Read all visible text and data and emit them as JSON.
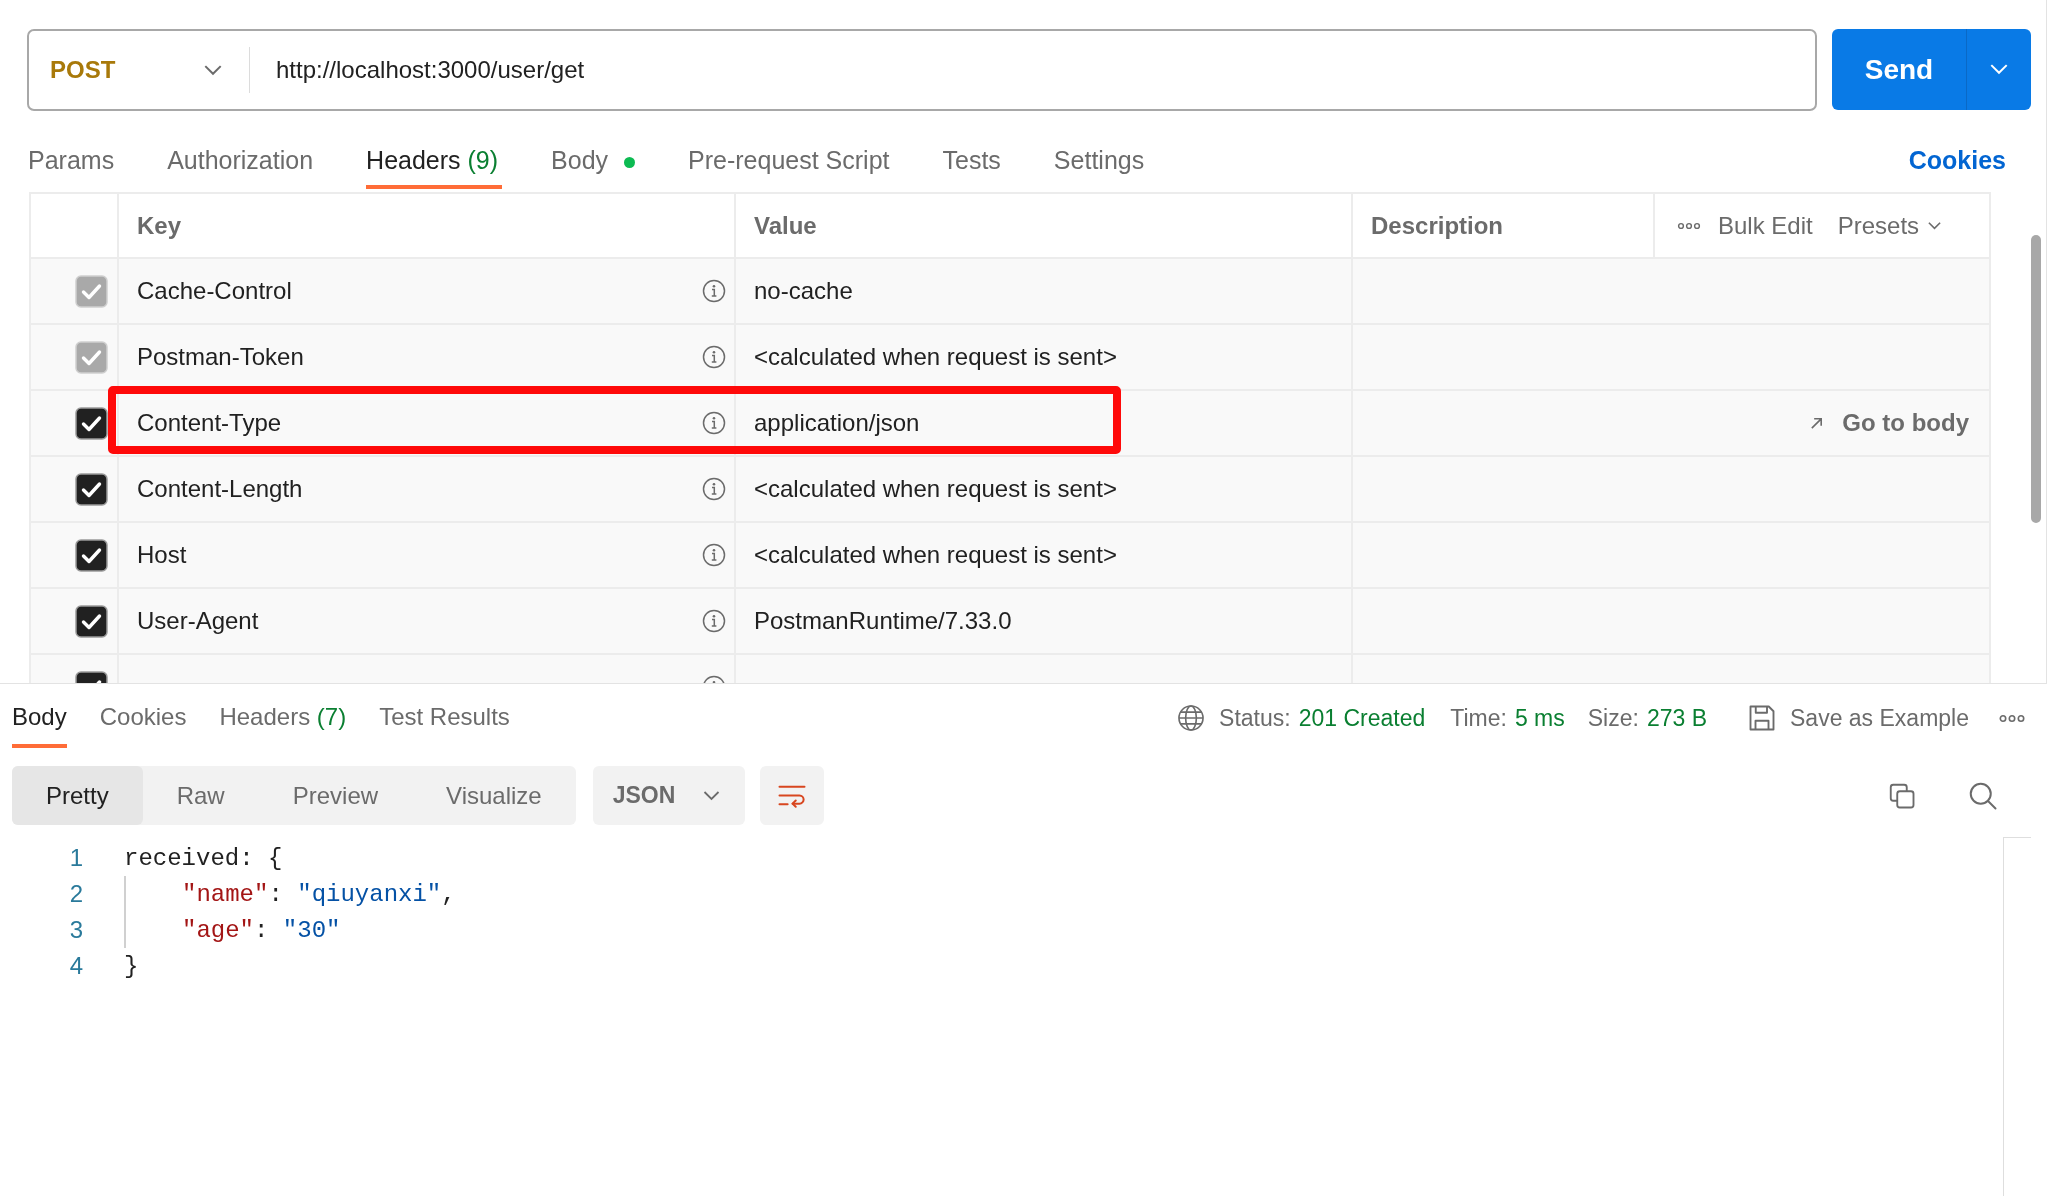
{
  "request": {
    "method": "POST",
    "url": "http://localhost:3000/user/get",
    "send": "Send"
  },
  "request_tabs": [
    {
      "label": "Params",
      "selected": false
    },
    {
      "label": "Authorization",
      "selected": false
    },
    {
      "label": "Headers",
      "count": "(9)",
      "selected": true
    },
    {
      "label": "Body",
      "dot": true,
      "selected": false
    },
    {
      "label": "Pre-request Script",
      "selected": false
    },
    {
      "label": "Tests",
      "selected": false
    },
    {
      "label": "Settings",
      "selected": false
    }
  ],
  "cookies_link": "Cookies",
  "headers_table": {
    "columns": [
      "Key",
      "Value",
      "Description"
    ],
    "actions": [
      "Bulk Edit",
      "Presets"
    ],
    "rows": [
      {
        "checked": true,
        "disabled": true,
        "highlighted": false,
        "key": "Cache-Control",
        "value": "no-cache"
      },
      {
        "checked": true,
        "disabled": true,
        "highlighted": false,
        "key": "Postman-Token",
        "value": "<calculated when request is sent>"
      },
      {
        "checked": true,
        "disabled": false,
        "highlighted": true,
        "key": "Content-Type",
        "value": "application/json",
        "link": "Go to body"
      },
      {
        "checked": true,
        "disabled": false,
        "highlighted": false,
        "key": "Content-Length",
        "value": "<calculated when request is sent>"
      },
      {
        "checked": true,
        "disabled": false,
        "highlighted": false,
        "key": "Host",
        "value": "<calculated when request is sent>"
      },
      {
        "checked": true,
        "disabled": false,
        "highlighted": false,
        "key": "User-Agent",
        "value": "PostmanRuntime/7.33.0"
      },
      {
        "checked": true,
        "disabled": false,
        "highlighted": false
      }
    ]
  },
  "response": {
    "tabs": [
      {
        "label": "Body",
        "selected": true
      },
      {
        "label": "Cookies",
        "selected": false
      },
      {
        "label": "Headers",
        "count": "(7)",
        "selected": false
      },
      {
        "label": "Test Results",
        "selected": false
      }
    ],
    "status_label": "Status:",
    "status": "201 Created",
    "time_label": "Time:",
    "time": "5 ms",
    "size_label": "Size:",
    "size": "273 B",
    "save": "Save as Example",
    "view_modes": [
      {
        "label": "Pretty",
        "selected": true
      },
      {
        "label": "Raw",
        "selected": false
      },
      {
        "label": "Preview",
        "selected": false
      },
      {
        "label": "Visualize",
        "selected": false
      }
    ],
    "format": "JSON",
    "code_lines": [
      {
        "number": "1",
        "tokens": [
          {
            "kind": "plain",
            "text": "received: {"
          }
        ],
        "children": [
          {
            "number": "2",
            "tokens": [
              {
                "kind": "key",
                "text": "\"name\""
              },
              {
                "kind": "plain",
                "text": ": "
              },
              {
                "kind": "string",
                "text": "\"qiuyanxi\""
              },
              {
                "kind": "plain",
                "text": ","
              }
            ]
          },
          {
            "number": "3",
            "tokens": [
              {
                "kind": "key",
                "text": "\"age\""
              },
              {
                "kind": "plain",
                "text": ": "
              },
              {
                "kind": "string",
                "text": "\"30\""
              }
            ]
          }
        ]
      },
      {
        "number": "4",
        "tokens": [
          {
            "kind": "plain",
            "text": "}"
          }
        ]
      }
    ]
  }
}
